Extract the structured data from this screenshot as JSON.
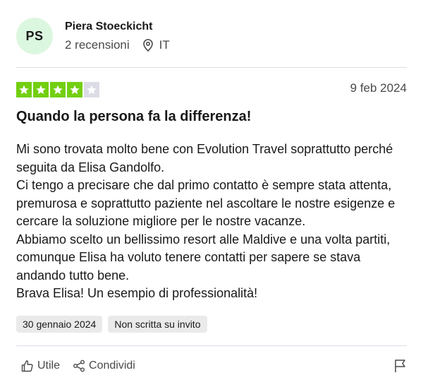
{
  "reviewer": {
    "initials": "PS",
    "name": "Piera Stoeckicht",
    "reviews_count": "2 recensioni",
    "country": "IT",
    "avatar_color": "#dcf7e0"
  },
  "review": {
    "rating": 4,
    "rating_max": 5,
    "star_color": "#73cf11",
    "date": "9 feb 2024",
    "title": "Quando la persona fa la differenza!",
    "paragraphs": [
      "Mi sono trovata molto bene con Evolution Travel soprattutto perché seguita da Elisa Gandolfo.",
      "Ci tengo a precisare che dal primo contatto è sempre stata attenta, premurosa e soprattutto paziente nel ascoltare le nostre esigenze e cercare la soluzione migliore per le nostre vacanze.",
      "Abbiamo scelto un bellissimo resort alle Maldive e una volta partiti, comunque Elisa ha voluto tenere contatti per sapere se stava andando tutto bene.",
      "Brava Elisa! Un esempio di professionalità!"
    ],
    "experience_date": "30 gennaio 2024",
    "invite_label": "Non scritta su invito"
  },
  "actions": {
    "useful_label": "Utile",
    "share_label": "Condividi",
    "icons": [
      "thumbs-up-icon",
      "share-icon",
      "flag-icon"
    ]
  }
}
